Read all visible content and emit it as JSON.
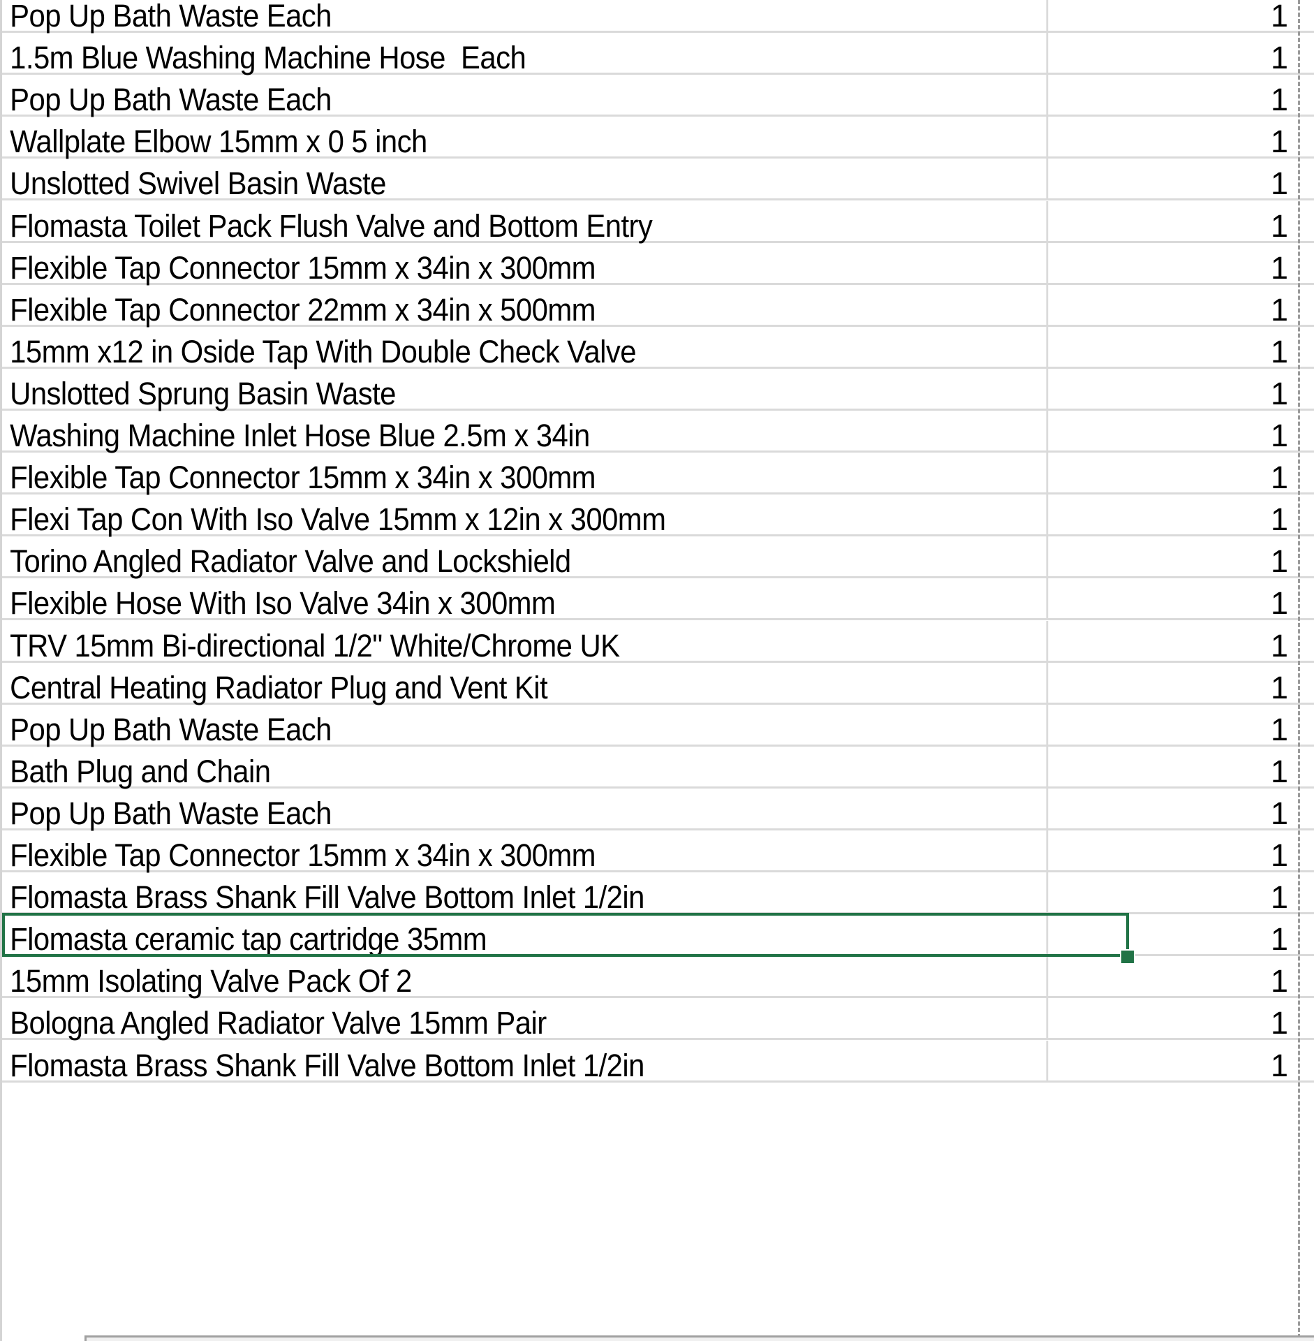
{
  "spreadsheet": {
    "selected_row_index": 22,
    "colors": {
      "selection": "#217346",
      "gridline": "#dadada",
      "page_break": "#9a9a9a"
    },
    "rows": [
      {
        "description": "Pop Up Bath Waste Each",
        "qty": "1"
      },
      {
        "description": "1.5m Blue Washing Machine Hose  Each",
        "qty": "1"
      },
      {
        "description": "Pop Up Bath Waste Each",
        "qty": "1"
      },
      {
        "description": "Wallplate Elbow 15mm x 0 5 inch",
        "qty": "1"
      },
      {
        "description": "Unslotted Swivel Basin Waste",
        "qty": "1"
      },
      {
        "description": "Flomasta Toilet Pack Flush Valve and Bottom Entry",
        "qty": "1"
      },
      {
        "description": "Flexible Tap Connector 15mm x 34in x 300mm",
        "qty": "1"
      },
      {
        "description": "Flexible Tap Connector 22mm x 34in x 500mm",
        "qty": "1"
      },
      {
        "description": "15mm x12 in Oside Tap With Double Check Valve",
        "qty": "1"
      },
      {
        "description": "Unslotted Sprung Basin Waste",
        "qty": "1"
      },
      {
        "description": "Washing Machine Inlet Hose Blue 2.5m x 34in",
        "qty": "1"
      },
      {
        "description": "Flexible Tap Connector 15mm x 34in x 300mm",
        "qty": "1"
      },
      {
        "description": "Flexi Tap Con With Iso Valve 15mm x 12in x 300mm",
        "qty": "1"
      },
      {
        "description": "Torino Angled Radiator Valve and Lockshield",
        "qty": "1"
      },
      {
        "description": "Flexible Hose With Iso Valve 34in x 300mm",
        "qty": "1"
      },
      {
        "description": "TRV 15mm Bi-directional 1/2\" White/Chrome UK",
        "qty": "1"
      },
      {
        "description": "Central Heating Radiator Plug and Vent Kit",
        "qty": "1"
      },
      {
        "description": "Pop Up Bath Waste Each",
        "qty": "1"
      },
      {
        "description": "Bath Plug and Chain",
        "qty": "1"
      },
      {
        "description": "Pop Up Bath Waste Each",
        "qty": "1"
      },
      {
        "description": "Flexible Tap Connector 15mm x 34in x 300mm",
        "qty": "1"
      },
      {
        "description": "Flomasta Brass Shank Fill Valve Bottom Inlet 1/2in",
        "qty": "1"
      },
      {
        "description": "Flomasta ceramic tap cartridge 35mm",
        "qty": "1"
      },
      {
        "description": "15mm Isolating Valve Pack Of 2",
        "qty": "1"
      },
      {
        "description": "Bologna Angled Radiator Valve 15mm Pair",
        "qty": "1"
      },
      {
        "description": "Flomasta Brass Shank Fill Valve Bottom Inlet 1/2in",
        "qty": "1"
      }
    ]
  }
}
